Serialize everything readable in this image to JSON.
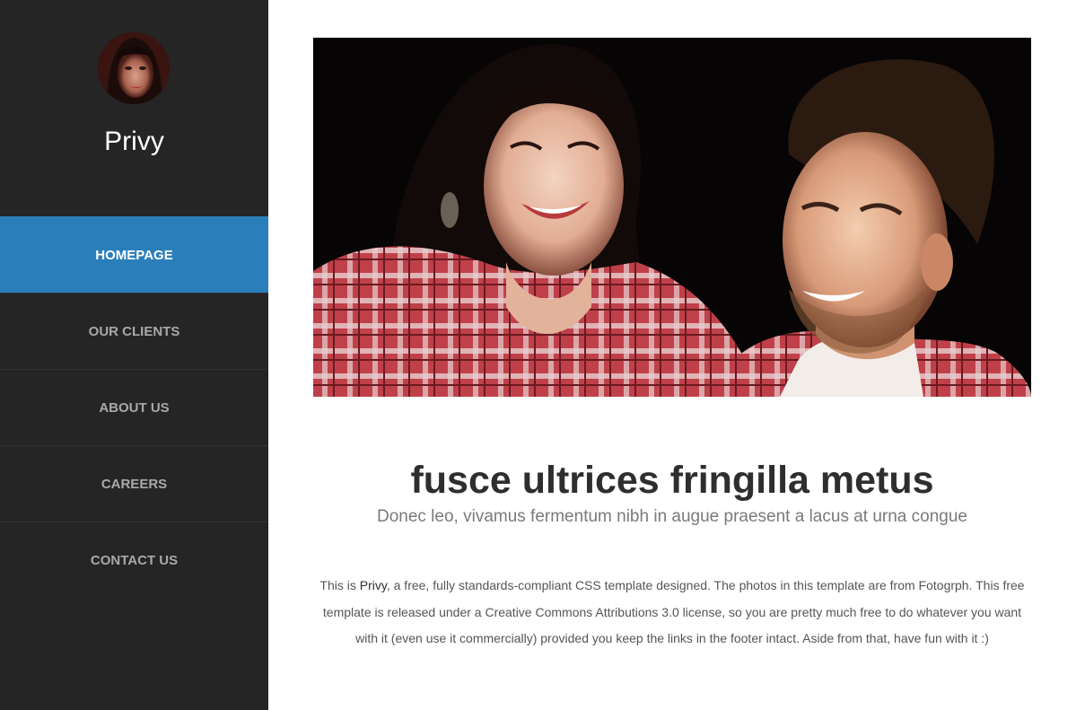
{
  "sidebar": {
    "site_title": "Privy",
    "avatar_alt": "woman portrait",
    "nav": [
      {
        "label": "HOMEPAGE",
        "active": true
      },
      {
        "label": "OUR CLIENTS",
        "active": false
      },
      {
        "label": "ABOUT US",
        "active": false
      },
      {
        "label": "CAREERS",
        "active": false
      },
      {
        "label": "CONTACT US",
        "active": false
      }
    ]
  },
  "main": {
    "hero_image": "couple-smiling-photo",
    "headline": "fusce ultrices fringilla metus",
    "subhead": "Donec leo, vivamus fermentum nibh in augue praesent a lacus at urna congue",
    "body": {
      "before": "This is ",
      "brand": "Privy",
      "after": ", a free, fully standards-compliant CSS template designed. The photos in this template are from Fotogrph. This free template is released under a Creative Commons Attributions 3.0 license, so you are pretty much free to do whatever you want with it (even use it commercially) provided you keep the links in the footer intact. Aside from that, have fun with it :)"
    }
  },
  "colors": {
    "sidebar_bg": "#252525",
    "active_nav": "#2a7fbb",
    "nav_text": "#a9a9a9",
    "headline": "#2e2e2e"
  }
}
